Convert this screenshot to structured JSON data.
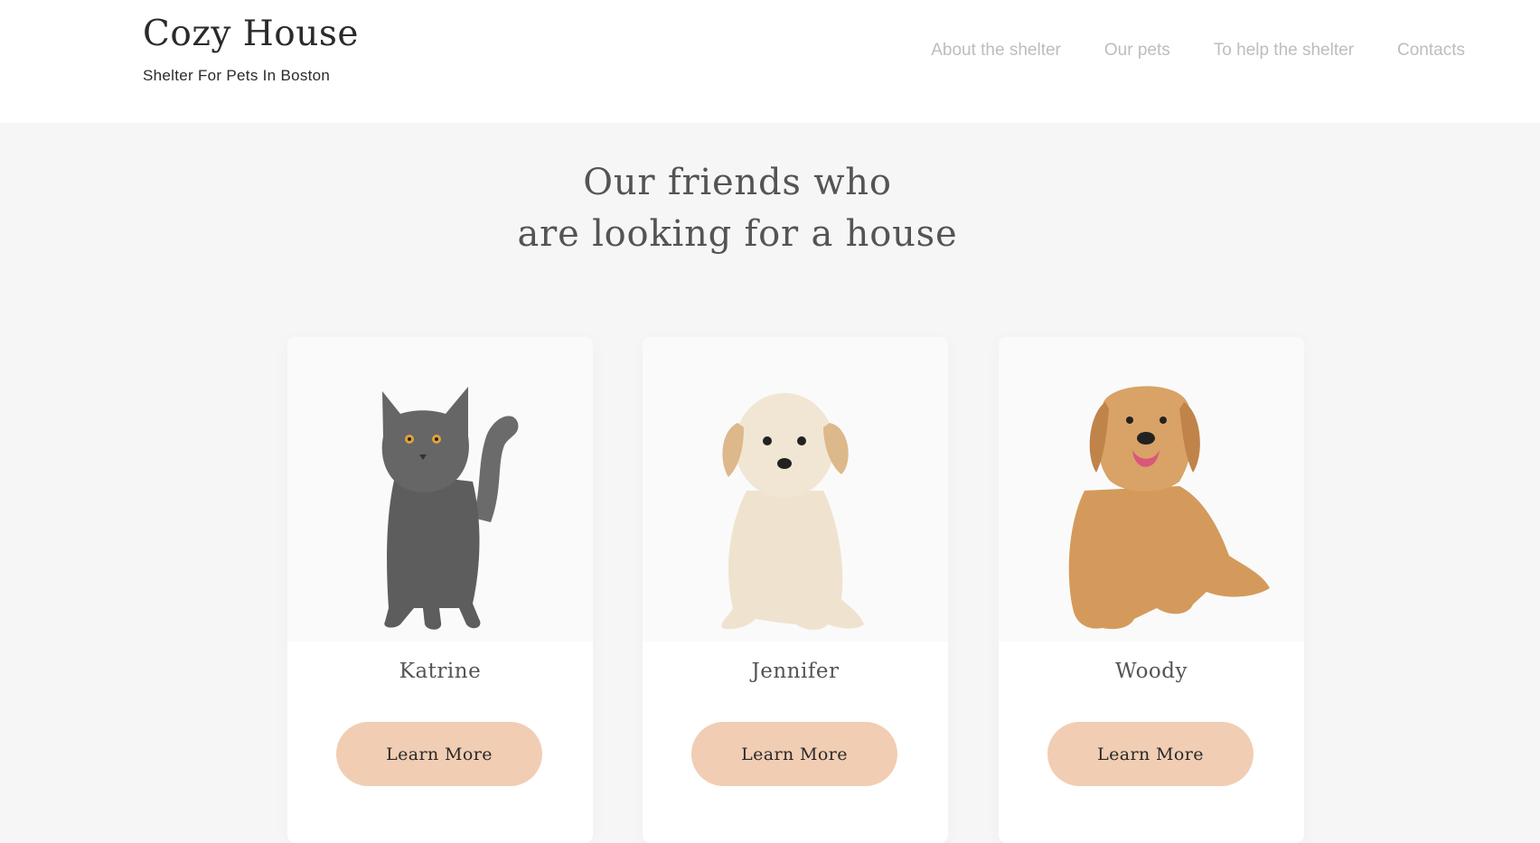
{
  "header": {
    "logo_title": "Cozy House",
    "logo_subtitle": "Shelter For Pets In Boston",
    "nav": [
      "About the shelter",
      "Our pets",
      "To help the shelter",
      "Contacts"
    ]
  },
  "main": {
    "heading_line1": "Our friends who",
    "heading_line2": "are looking for a house"
  },
  "pets": [
    {
      "name": "Katrine",
      "button": "Learn More",
      "icon": "cat-photo"
    },
    {
      "name": "Jennifer",
      "button": "Learn More",
      "icon": "puppy-photo"
    },
    {
      "name": "Woody",
      "button": "Learn More",
      "icon": "golden-retriever-photo"
    }
  ],
  "colors": {
    "accent": "#f1cdb3",
    "background": "#f6f6f6",
    "nav_text": "#bdbdbd",
    "heading_text": "#545454"
  }
}
